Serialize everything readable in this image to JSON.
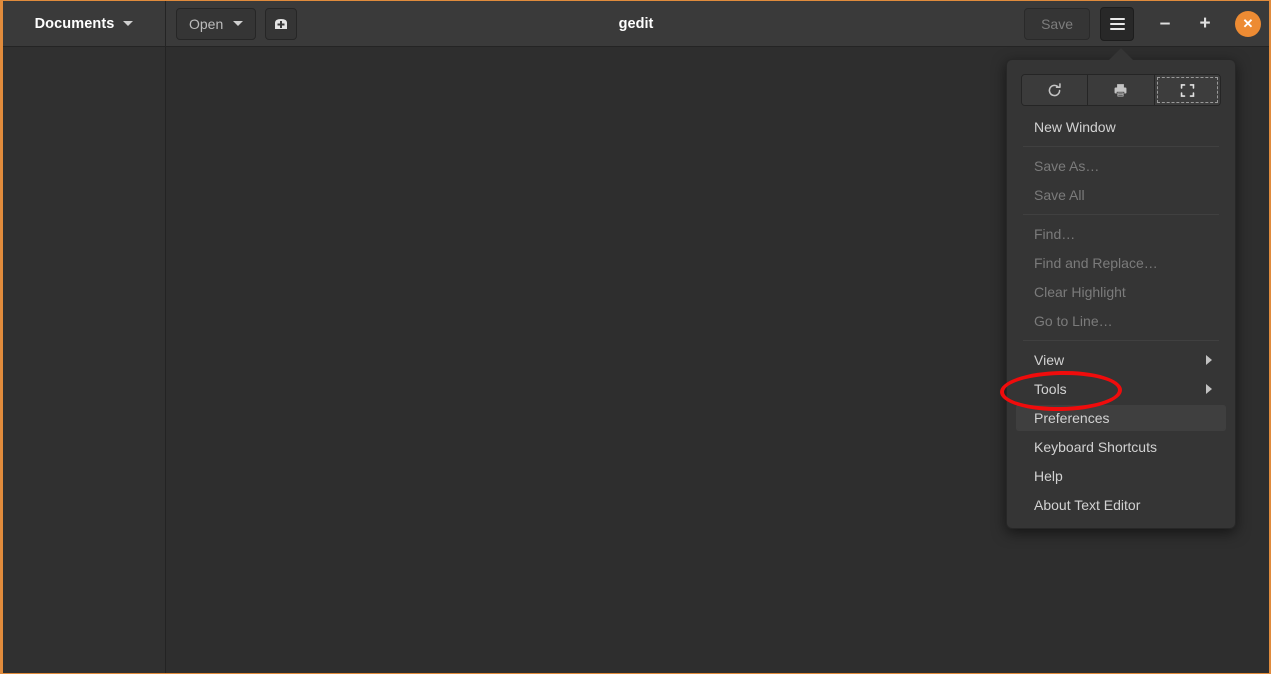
{
  "window": {
    "title": "gedit",
    "accent_color": "#ed8b33",
    "background": "#2e2e2e"
  },
  "headerbar": {
    "documents_button": {
      "label": "Documents",
      "icon": "chevron-down-icon"
    },
    "open_button": {
      "label": "Open",
      "icon": "chevron-down-icon"
    },
    "new_document_button": {
      "icon": "new-document-icon"
    },
    "save_button": {
      "label": "Save",
      "enabled": false
    },
    "menu_button": {
      "icon": "hamburger-menu-icon",
      "active": true
    },
    "window_controls": {
      "minimize": "–",
      "maximize": "+",
      "close": "✕"
    }
  },
  "menu": {
    "quick_actions": [
      {
        "name": "reload",
        "icon": "reload-icon",
        "focused": false
      },
      {
        "name": "print",
        "icon": "print-icon",
        "focused": false
      },
      {
        "name": "fullscreen",
        "icon": "fullscreen-icon",
        "focused": true
      }
    ],
    "groups": [
      {
        "items": [
          {
            "label": "New Window",
            "enabled": true,
            "submenu": false,
            "selected": false
          }
        ]
      },
      {
        "items": [
          {
            "label": "Save As…",
            "enabled": false,
            "submenu": false,
            "selected": false
          },
          {
            "label": "Save All",
            "enabled": false,
            "submenu": false,
            "selected": false
          }
        ]
      },
      {
        "items": [
          {
            "label": "Find…",
            "enabled": false,
            "submenu": false,
            "selected": false
          },
          {
            "label": "Find and Replace…",
            "enabled": false,
            "submenu": false,
            "selected": false
          },
          {
            "label": "Clear Highlight",
            "enabled": false,
            "submenu": false,
            "selected": false
          },
          {
            "label": "Go to Line…",
            "enabled": false,
            "submenu": false,
            "selected": false
          }
        ]
      },
      {
        "items": [
          {
            "label": "View",
            "enabled": true,
            "submenu": true,
            "selected": false
          },
          {
            "label": "Tools",
            "enabled": true,
            "submenu": true,
            "selected": false
          },
          {
            "label": "Preferences",
            "enabled": true,
            "submenu": false,
            "selected": true
          },
          {
            "label": "Keyboard Shortcuts",
            "enabled": true,
            "submenu": false,
            "selected": false
          },
          {
            "label": "Help",
            "enabled": true,
            "submenu": false,
            "selected": false
          },
          {
            "label": "About Text Editor",
            "enabled": true,
            "submenu": false,
            "selected": false
          }
        ]
      }
    ]
  },
  "annotation": {
    "shape": "ellipse",
    "color": "#f00c0c",
    "target_label": "Preferences"
  }
}
